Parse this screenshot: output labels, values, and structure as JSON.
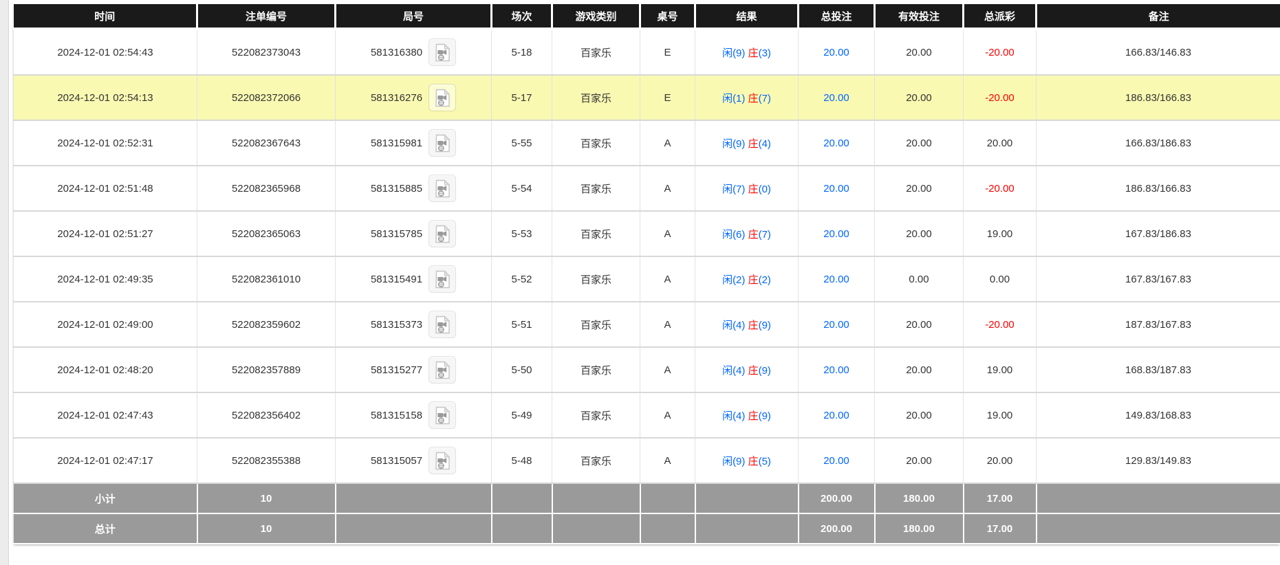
{
  "table": {
    "columns": [
      {
        "key": "time",
        "label": "时间"
      },
      {
        "key": "bet_id",
        "label": "注单编号"
      },
      {
        "key": "round",
        "label": "局号"
      },
      {
        "key": "session",
        "label": "场次"
      },
      {
        "key": "game",
        "label": "游戏类别"
      },
      {
        "key": "table_no",
        "label": "桌号"
      },
      {
        "key": "result",
        "label": "结果"
      },
      {
        "key": "total_bet",
        "label": "总投注"
      },
      {
        "key": "valid_bet",
        "label": "有效投注"
      },
      {
        "key": "payout",
        "label": "总派彩"
      },
      {
        "key": "remark",
        "label": "备注"
      }
    ],
    "icons": {
      "round_cell_icon": "video-file-icon"
    },
    "rows": [
      {
        "time": "2024-12-01 02:54:43",
        "bet_id": "522082373043",
        "round": "581316380",
        "session": "5-18",
        "game": "百家乐",
        "table_no": "E",
        "player_label": "闲",
        "player_value": "9",
        "banker_label": "庄",
        "banker_value": "3",
        "total_bet": "20.00",
        "valid_bet": "20.00",
        "payout": "-20.00",
        "remark": "166.83/146.83",
        "highlighted": false
      },
      {
        "time": "2024-12-01 02:54:13",
        "bet_id": "522082372066",
        "round": "581316276",
        "session": "5-17",
        "game": "百家乐",
        "table_no": "E",
        "player_label": "闲",
        "player_value": "1",
        "banker_label": "庄",
        "banker_value": "7",
        "total_bet": "20.00",
        "valid_bet": "20.00",
        "payout": "-20.00",
        "remark": "186.83/166.83",
        "highlighted": true
      },
      {
        "time": "2024-12-01 02:52:31",
        "bet_id": "522082367643",
        "round": "581315981",
        "session": "5-55",
        "game": "百家乐",
        "table_no": "A",
        "player_label": "闲",
        "player_value": "9",
        "banker_label": "庄",
        "banker_value": "4",
        "total_bet": "20.00",
        "valid_bet": "20.00",
        "payout": "20.00",
        "remark": "166.83/186.83",
        "highlighted": false
      },
      {
        "time": "2024-12-01 02:51:48",
        "bet_id": "522082365968",
        "round": "581315885",
        "session": "5-54",
        "game": "百家乐",
        "table_no": "A",
        "player_label": "闲",
        "player_value": "7",
        "banker_label": "庄",
        "banker_value": "0",
        "total_bet": "20.00",
        "valid_bet": "20.00",
        "payout": "-20.00",
        "remark": "186.83/166.83",
        "highlighted": false
      },
      {
        "time": "2024-12-01 02:51:27",
        "bet_id": "522082365063",
        "round": "581315785",
        "session": "5-53",
        "game": "百家乐",
        "table_no": "A",
        "player_label": "闲",
        "player_value": "6",
        "banker_label": "庄",
        "banker_value": "7",
        "total_bet": "20.00",
        "valid_bet": "20.00",
        "payout": "19.00",
        "remark": "167.83/186.83",
        "highlighted": false
      },
      {
        "time": "2024-12-01 02:49:35",
        "bet_id": "522082361010",
        "round": "581315491",
        "session": "5-52",
        "game": "百家乐",
        "table_no": "A",
        "player_label": "闲",
        "player_value": "2",
        "banker_label": "庄",
        "banker_value": "2",
        "total_bet": "20.00",
        "valid_bet": "0.00",
        "payout": "0.00",
        "remark": "167.83/167.83",
        "highlighted": false
      },
      {
        "time": "2024-12-01 02:49:00",
        "bet_id": "522082359602",
        "round": "581315373",
        "session": "5-51",
        "game": "百家乐",
        "table_no": "A",
        "player_label": "闲",
        "player_value": "4",
        "banker_label": "庄",
        "banker_value": "9",
        "total_bet": "20.00",
        "valid_bet": "20.00",
        "payout": "-20.00",
        "remark": "187.83/167.83",
        "highlighted": false
      },
      {
        "time": "2024-12-01 02:48:20",
        "bet_id": "522082357889",
        "round": "581315277",
        "session": "5-50",
        "game": "百家乐",
        "table_no": "A",
        "player_label": "闲",
        "player_value": "4",
        "banker_label": "庄",
        "banker_value": "9",
        "total_bet": "20.00",
        "valid_bet": "20.00",
        "payout": "19.00",
        "remark": "168.83/187.83",
        "highlighted": false
      },
      {
        "time": "2024-12-01 02:47:43",
        "bet_id": "522082356402",
        "round": "581315158",
        "session": "5-49",
        "game": "百家乐",
        "table_no": "A",
        "player_label": "闲",
        "player_value": "4",
        "banker_label": "庄",
        "banker_value": "9",
        "total_bet": "20.00",
        "valid_bet": "20.00",
        "payout": "19.00",
        "remark": "149.83/168.83",
        "highlighted": false
      },
      {
        "time": "2024-12-01 02:47:17",
        "bet_id": "522082355388",
        "round": "581315057",
        "session": "5-48",
        "game": "百家乐",
        "table_no": "A",
        "player_label": "闲",
        "player_value": "9",
        "banker_label": "庄",
        "banker_value": "5",
        "total_bet": "20.00",
        "valid_bet": "20.00",
        "payout": "20.00",
        "remark": "129.83/149.83",
        "highlighted": false
      }
    ],
    "summary_rows": [
      {
        "label": "小计",
        "count": "10",
        "total_bet": "200.00",
        "valid_bet": "180.00",
        "payout": "17.00"
      },
      {
        "label": "总计",
        "count": "10",
        "total_bet": "200.00",
        "valid_bet": "180.00",
        "payout": "17.00"
      }
    ]
  },
  "colors": {
    "header_bg": "#1a1a1a",
    "row_highlight": "#f9f9b2",
    "summary_bg": "#9a9a9a",
    "link_blue": "#0066ff",
    "banker_red": "#ff0000",
    "negative_red": "#ff0000"
  }
}
